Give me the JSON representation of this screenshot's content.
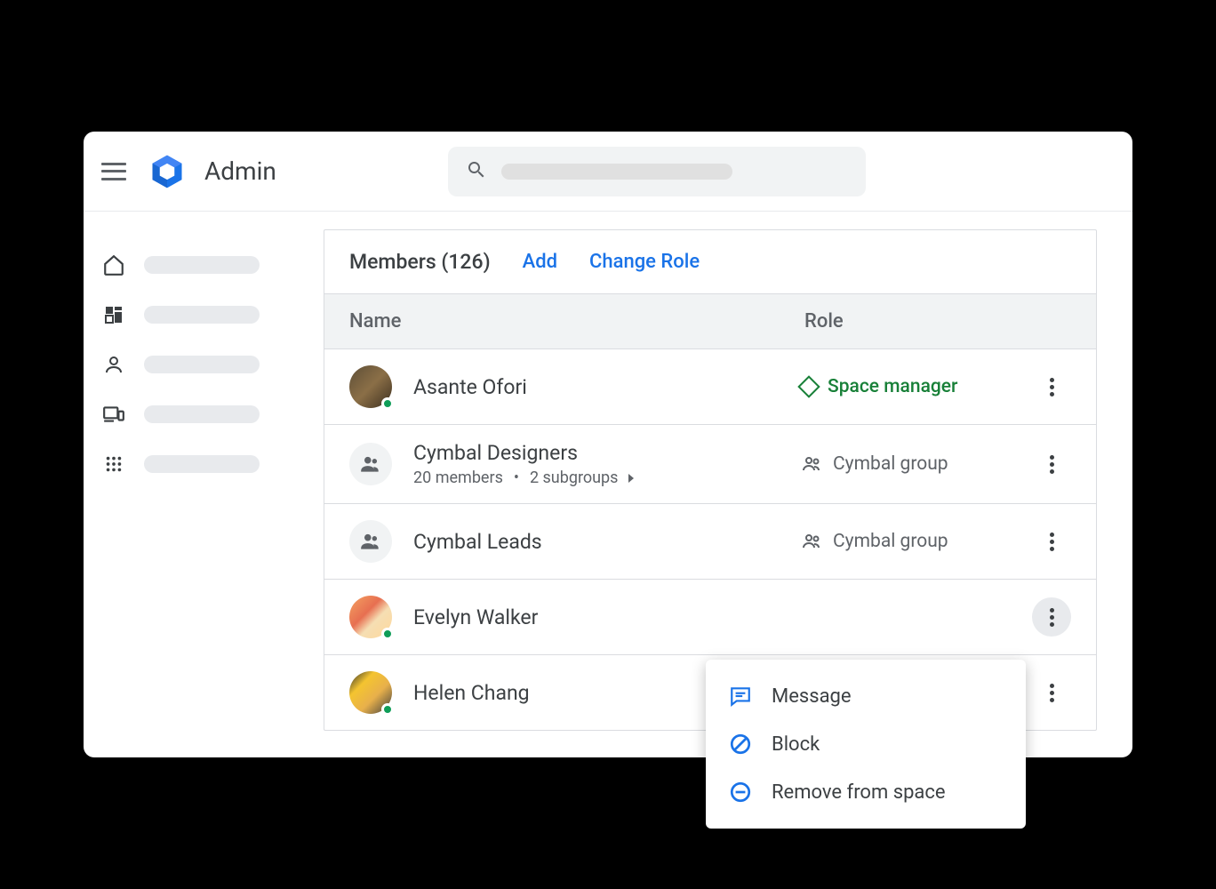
{
  "header": {
    "app_title": "Admin"
  },
  "panel": {
    "title": "Members (126)",
    "add_label": "Add",
    "change_role_label": "Change Role",
    "columns": {
      "name": "Name",
      "role": "Role"
    }
  },
  "members": [
    {
      "name": "Asante Ofori",
      "role": "Space manager",
      "role_type": "manager",
      "avatar_type": "person1",
      "has_status": true
    },
    {
      "name": "Cymbal Designers",
      "sub_members": "20 members",
      "sub_groups": "2 subgroups",
      "role": "Cymbal group",
      "role_type": "group",
      "avatar_type": "group",
      "has_status": false
    },
    {
      "name": "Cymbal Leads",
      "role": "Cymbal group",
      "role_type": "group",
      "avatar_type": "group",
      "has_status": false
    },
    {
      "name": "Evelyn Walker",
      "avatar_type": "person2",
      "has_status": true,
      "menu_open": true
    },
    {
      "name": "Helen Chang",
      "avatar_type": "person3",
      "has_status": true
    }
  ],
  "context_menu": {
    "message": "Message",
    "block": "Block",
    "remove": "Remove from space"
  }
}
